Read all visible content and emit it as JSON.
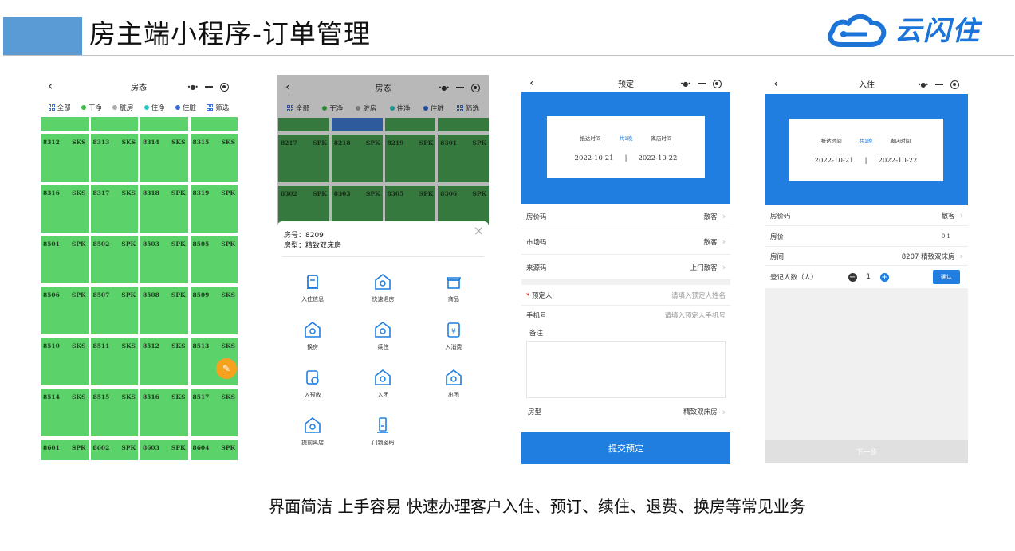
{
  "header": {
    "title": "房主端小程序-订单管理",
    "logo_text": "云闪住"
  },
  "caption": "界面简洁 上手容易  快速办理客户入住、预订、续住、退费、换房等常见业务",
  "colors": {
    "accent": "#5b9bd5",
    "blue": "#1f7ee0",
    "room_green": "#5cd26b",
    "fab": "#f6a21f"
  },
  "phone1": {
    "nav_title": "房态",
    "legend": [
      {
        "label": "全部",
        "icon": "grid-icon"
      },
      {
        "label": "干净",
        "color": "#3cbf4a"
      },
      {
        "label": "脏房",
        "color": "#aaaaaa"
      },
      {
        "label": "住净",
        "color": "#2ec6c6"
      },
      {
        "label": "住脏",
        "color": "#2f67d8"
      },
      {
        "label": "筛选",
        "icon": "grid-icon"
      }
    ],
    "rooms": [
      {
        "no": "8312",
        "type": "SKS"
      },
      {
        "no": "8313",
        "type": "SKS"
      },
      {
        "no": "8314",
        "type": "SKS"
      },
      {
        "no": "8315",
        "type": "SKS"
      },
      {
        "no": "8316",
        "type": "SKS"
      },
      {
        "no": "8317",
        "type": "SKS"
      },
      {
        "no": "8318",
        "type": "SPK"
      },
      {
        "no": "8319",
        "type": "SPK"
      },
      {
        "no": "8501",
        "type": "SPK"
      },
      {
        "no": "8502",
        "type": "SPK"
      },
      {
        "no": "8503",
        "type": "SPK"
      },
      {
        "no": "8505",
        "type": "SPK"
      },
      {
        "no": "8506",
        "type": "SPK"
      },
      {
        "no": "8507",
        "type": "SPK"
      },
      {
        "no": "8508",
        "type": "SPK"
      },
      {
        "no": "8509",
        "type": "SKS"
      },
      {
        "no": "8510",
        "type": "SKS"
      },
      {
        "no": "8511",
        "type": "SKS"
      },
      {
        "no": "8512",
        "type": "SKS"
      },
      {
        "no": "8513",
        "type": "SKS"
      },
      {
        "no": "8514",
        "type": "SKS"
      },
      {
        "no": "8515",
        "type": "SKS"
      },
      {
        "no": "8516",
        "type": "SKS"
      },
      {
        "no": "8517",
        "type": "SKS"
      },
      {
        "no": "8601",
        "type": "SPK"
      },
      {
        "no": "8602",
        "type": "SPK"
      },
      {
        "no": "8603",
        "type": "SPK"
      },
      {
        "no": "8604",
        "type": "SPK"
      }
    ]
  },
  "phone2": {
    "nav_title": "房态",
    "rooms": [
      {
        "no": "8217",
        "type": "SPK"
      },
      {
        "no": "8218",
        "type": "SPK"
      },
      {
        "no": "8219",
        "type": "SPK"
      },
      {
        "no": "8301",
        "type": "SPK"
      },
      {
        "no": "8302",
        "type": "SPK"
      },
      {
        "no": "8303",
        "type": "SPK"
      },
      {
        "no": "8305",
        "type": "SPK"
      },
      {
        "no": "8306",
        "type": "SPK"
      }
    ],
    "room_no_line": "房号：8209",
    "room_type_line": "房型：精致双床房",
    "actions": [
      "入住信息",
      "快速退房",
      "商品",
      "换房",
      "续住",
      "入消费",
      "入预收",
      "入团",
      "出团",
      "提前离店",
      "门锁密码"
    ]
  },
  "phone3": {
    "nav_title": "预定",
    "arrive_label": "抵达时间",
    "nights_label": "共1晚",
    "leave_label": "离店时间",
    "arrive_date": "2022-10-21",
    "leave_date": "2022-10-22",
    "date_sep": "|",
    "rows": [
      {
        "label": "房价码",
        "value": "散客"
      },
      {
        "label": "市场码",
        "value": "散客"
      },
      {
        "label": "来源码",
        "value": "上门散客"
      }
    ],
    "booker_label": "预定人",
    "booker_placeholder": "请填入预定人姓名",
    "phone_label": "手机号",
    "phone_placeholder": "请填入预定人手机号",
    "remark_label": "备注",
    "roomtype_label": "房型",
    "roomtype_value": "精致双床房",
    "submit_label": "提交预定"
  },
  "phone4": {
    "nav_title": "入住",
    "arrive_label": "抵达时间",
    "nights_label": "共1晚",
    "leave_label": "离店时间",
    "arrive_date": "2022-10-21",
    "leave_date": "2022-10-22",
    "date_sep": "|",
    "price_code_label": "房价码",
    "price_code_value": "散客",
    "price_label": "房价",
    "price_value": "0.1",
    "room_label": "房间",
    "room_value": "8207 精致双床房",
    "guests_label": "登记人数（人）",
    "guests_value": "1",
    "confirm_label": "确认",
    "next_label": "下一步"
  }
}
